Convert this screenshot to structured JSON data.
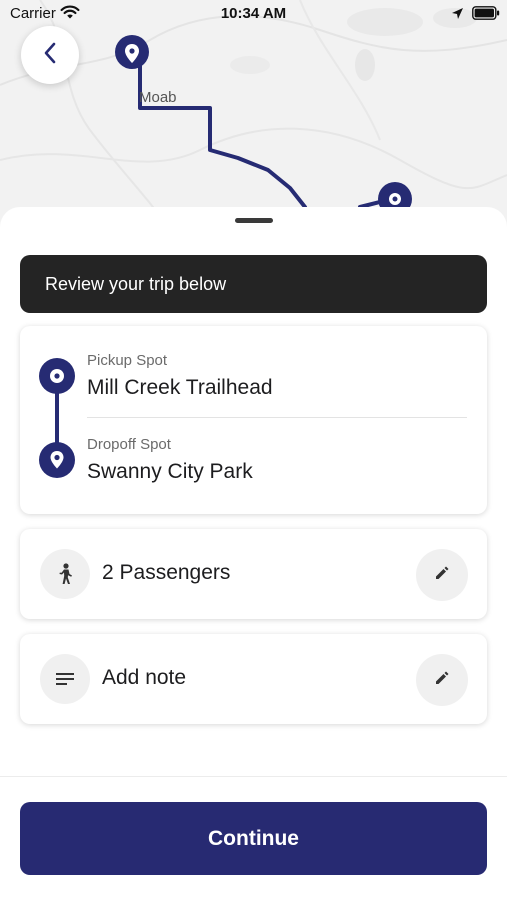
{
  "status_bar": {
    "carrier": "Carrier",
    "time": "10:34 AM",
    "icons": [
      "wifi-icon",
      "location-arrow-icon",
      "battery-icon"
    ]
  },
  "map": {
    "place_label": "Moab",
    "route_color": "#262b73"
  },
  "navigation": {
    "back_icon": "chevron-left-icon"
  },
  "sheet": {
    "banner_text": "Review your trip below",
    "trip": {
      "pickup_label": "Pickup Spot",
      "pickup_value": "Mill Creek Trailhead",
      "dropoff_label": "Dropoff Spot",
      "dropoff_value": "Swanny City Park"
    },
    "passengers": {
      "icon": "person-icon",
      "text": "2 Passengers",
      "edit_icon": "pencil-icon"
    },
    "note": {
      "icon": "notes-icon",
      "text": "Add note",
      "edit_icon": "pencil-icon"
    },
    "continue_label": "Continue"
  },
  "colors": {
    "brand": "#262b73",
    "banner": "#242424",
    "icon_circle": "#f0f0f0"
  }
}
